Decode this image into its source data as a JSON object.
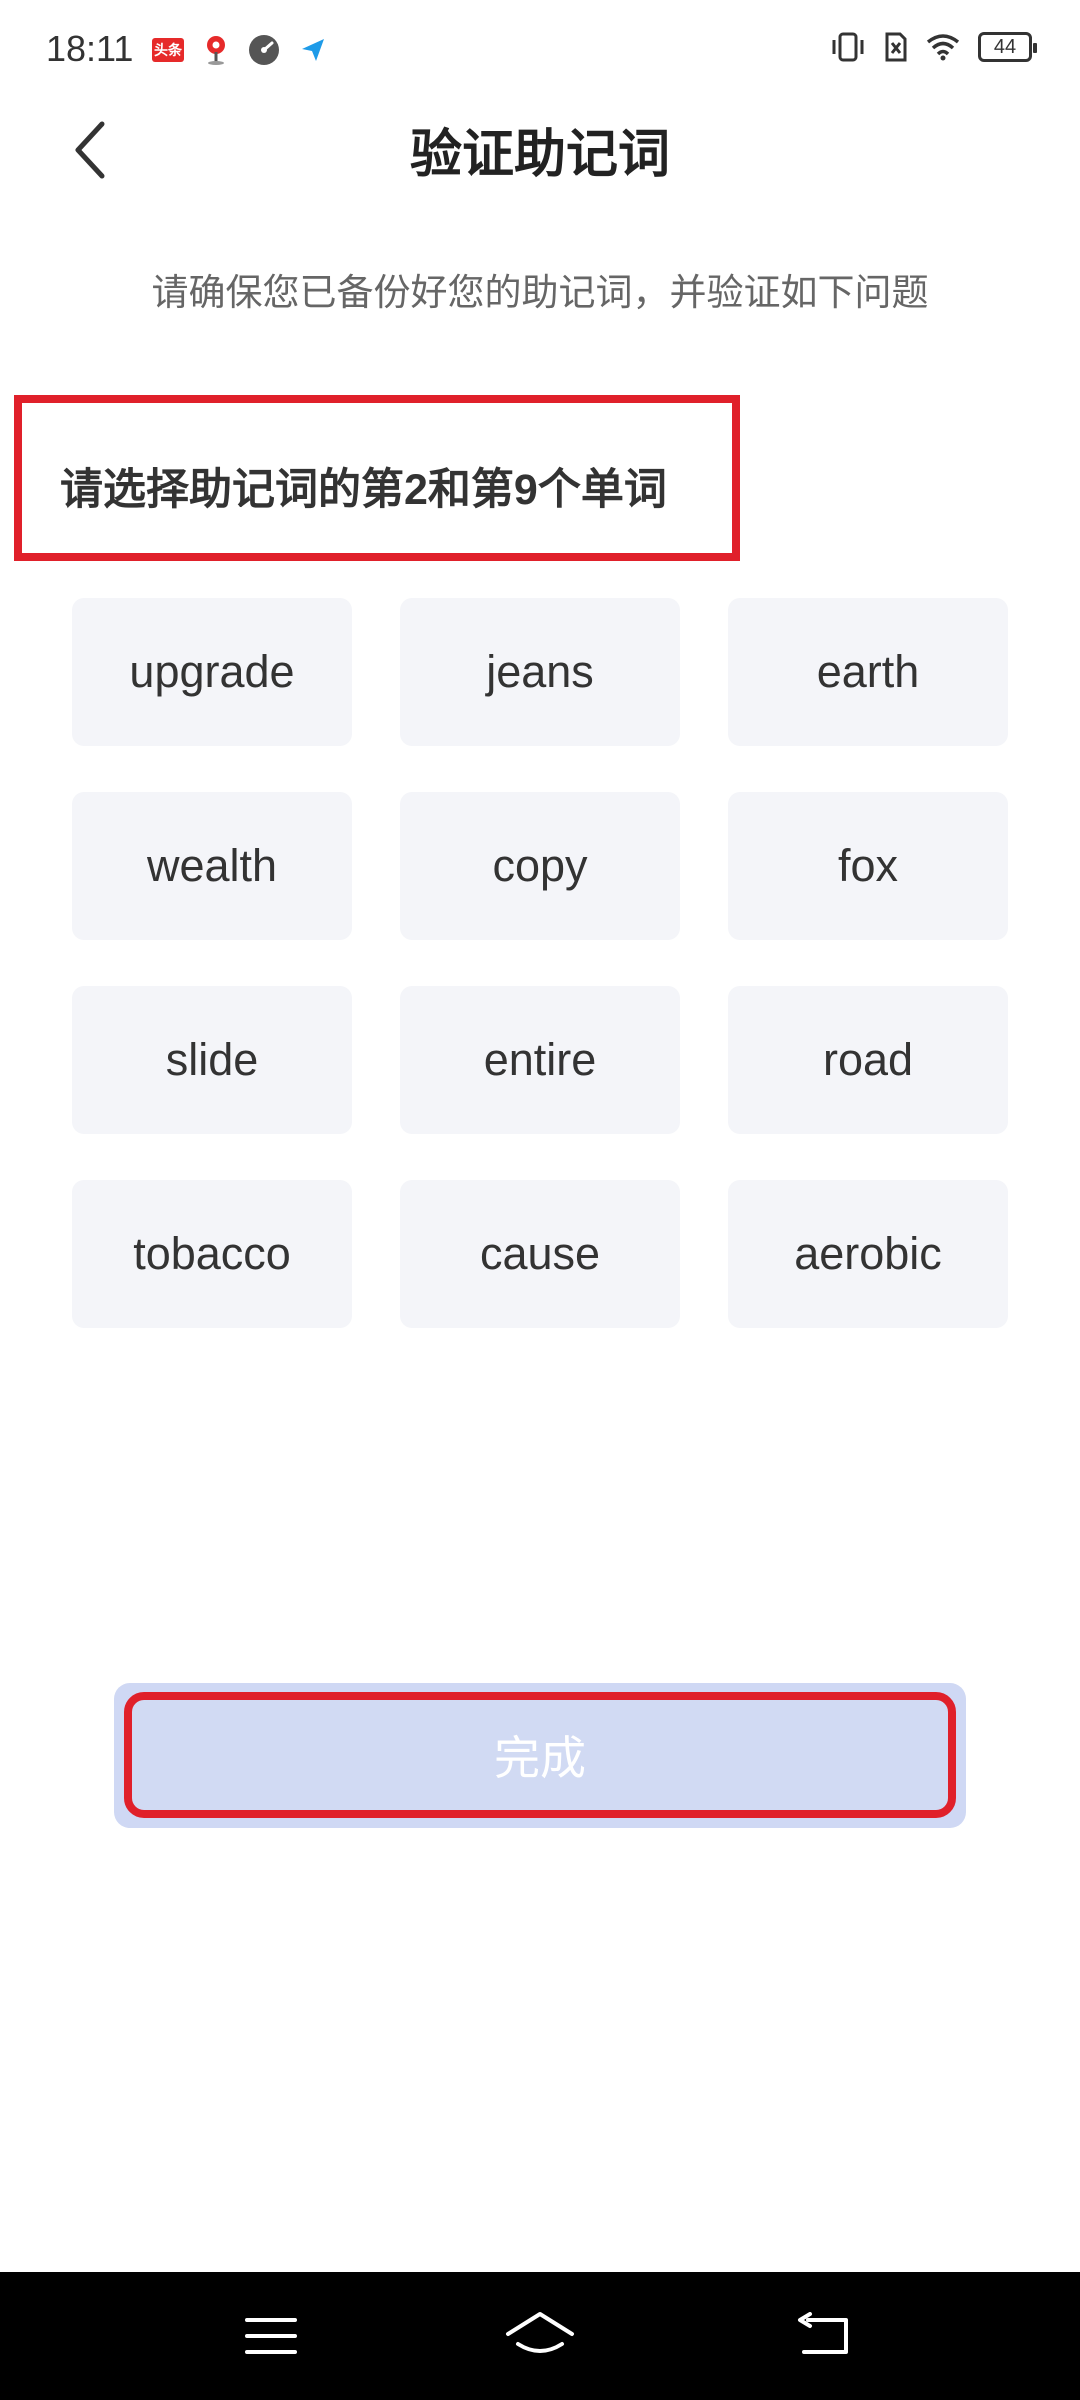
{
  "status_bar": {
    "time": "18:11",
    "notification_icons": [
      "toutiao-icon",
      "location-pin-icon",
      "speedometer-icon",
      "send-icon"
    ],
    "toutiao_label": "头条",
    "system_icons": [
      "vibrate-icon",
      "sim-off-icon",
      "wifi-icon",
      "battery-icon"
    ],
    "battery_level": "44"
  },
  "header": {
    "title": "验证助记词",
    "back_icon": "chevron-left-icon"
  },
  "subtitle": "请确保您已备份好您的助记词，并验证如下问题",
  "question": "请选择助记词的第2和第9个单词",
  "words": [
    "upgrade",
    "jeans",
    "earth",
    "wealth",
    "copy",
    "fox",
    "slide",
    "entire",
    "road",
    "tobacco",
    "cause",
    "aerobic"
  ],
  "done_button": {
    "label": "完成"
  },
  "nav_bar": {
    "icons": [
      "menu-icon",
      "home-icon",
      "back-arrow-icon"
    ]
  },
  "colors": {
    "highlight_border": "#e0202a",
    "chip_background": "#f4f5f9",
    "button_disabled": "#d1daf3",
    "text_primary": "#222222",
    "text_secondary": "#666666"
  }
}
